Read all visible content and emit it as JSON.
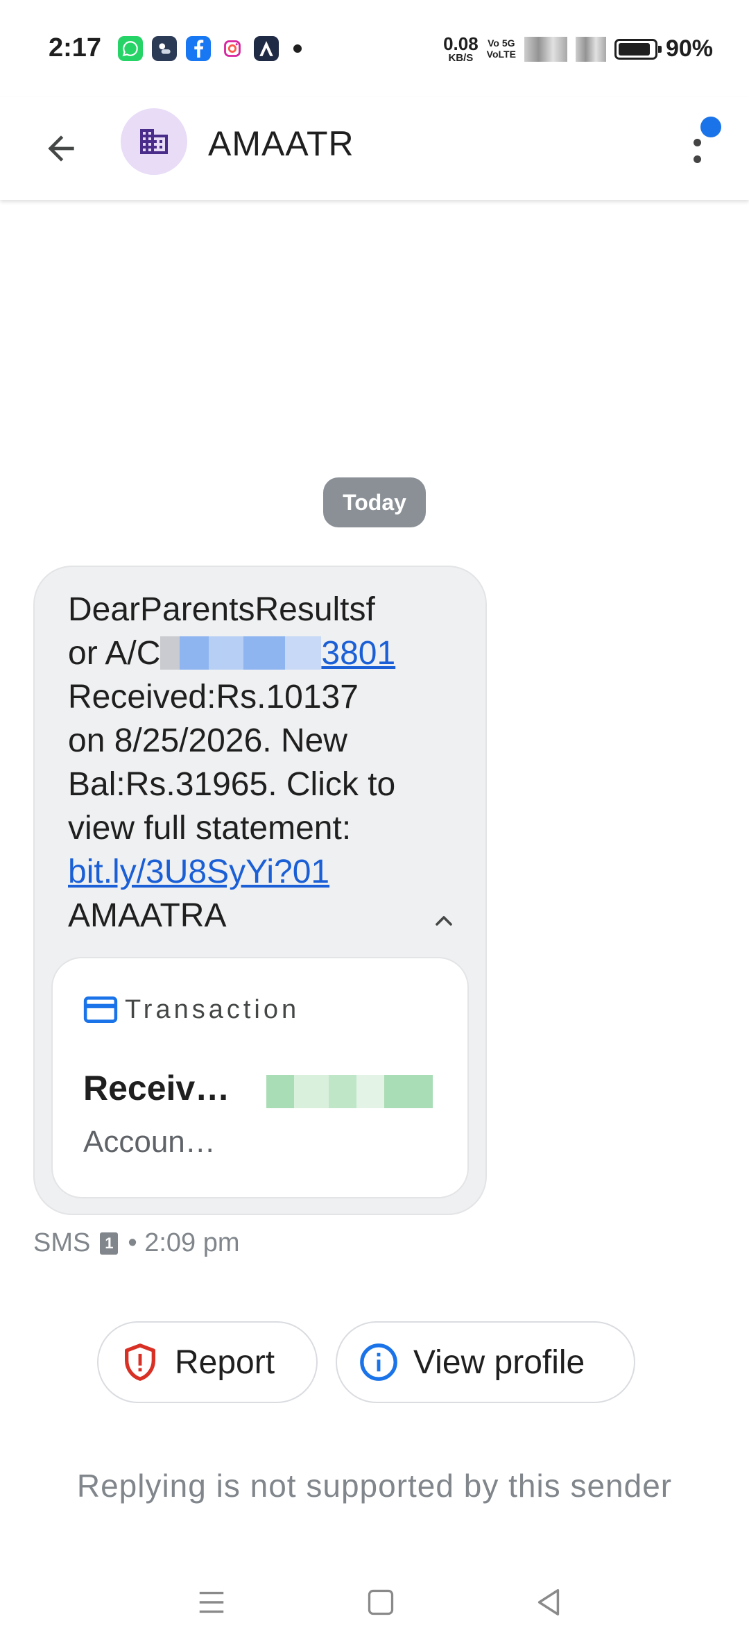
{
  "status_bar": {
    "time": "2:17",
    "app_icons": [
      "whatsapp-icon",
      "weather-icon",
      "facebook-icon",
      "instagram-icon",
      "arch-icon"
    ],
    "net_speed_value": "0.08",
    "net_speed_unit": "KB/S",
    "volte_top": "Vo 5G",
    "volte_bottom": "VoLTE",
    "battery_percent": "90%"
  },
  "header": {
    "contact_name": "AMAATR",
    "avatar_icon": "building-icon",
    "notification_color": "#1a73e8"
  },
  "conversation": {
    "date_chip": "Today",
    "message": {
      "line1": "DearParentsResultsf",
      "line2_prefix": "or A/C",
      "line2_link_suffix": "3801",
      "line3": "Received:Rs.10137",
      "line4": "on 8/25/2026. New",
      "line5": "Bal:Rs.31965. Click to",
      "line6": "view full statement:",
      "link": "bit.ly/3U8SyYi?01",
      "line8": "AMAATRA"
    },
    "card": {
      "label": "Transaction",
      "title": "Receiv…",
      "subtitle": "Accoun…"
    },
    "meta": {
      "type": "SMS",
      "sim": "1",
      "time": "• 2:09 pm"
    }
  },
  "actions": {
    "report_label": "Report",
    "view_profile_label": "View profile"
  },
  "footer": {
    "reply_note": "Replying is not supported by this sender"
  },
  "colors": {
    "accent": "#1a73e8",
    "report_red": "#d93025",
    "bubble_bg": "#eff0f1",
    "date_chip_bg": "#8a9096"
  }
}
